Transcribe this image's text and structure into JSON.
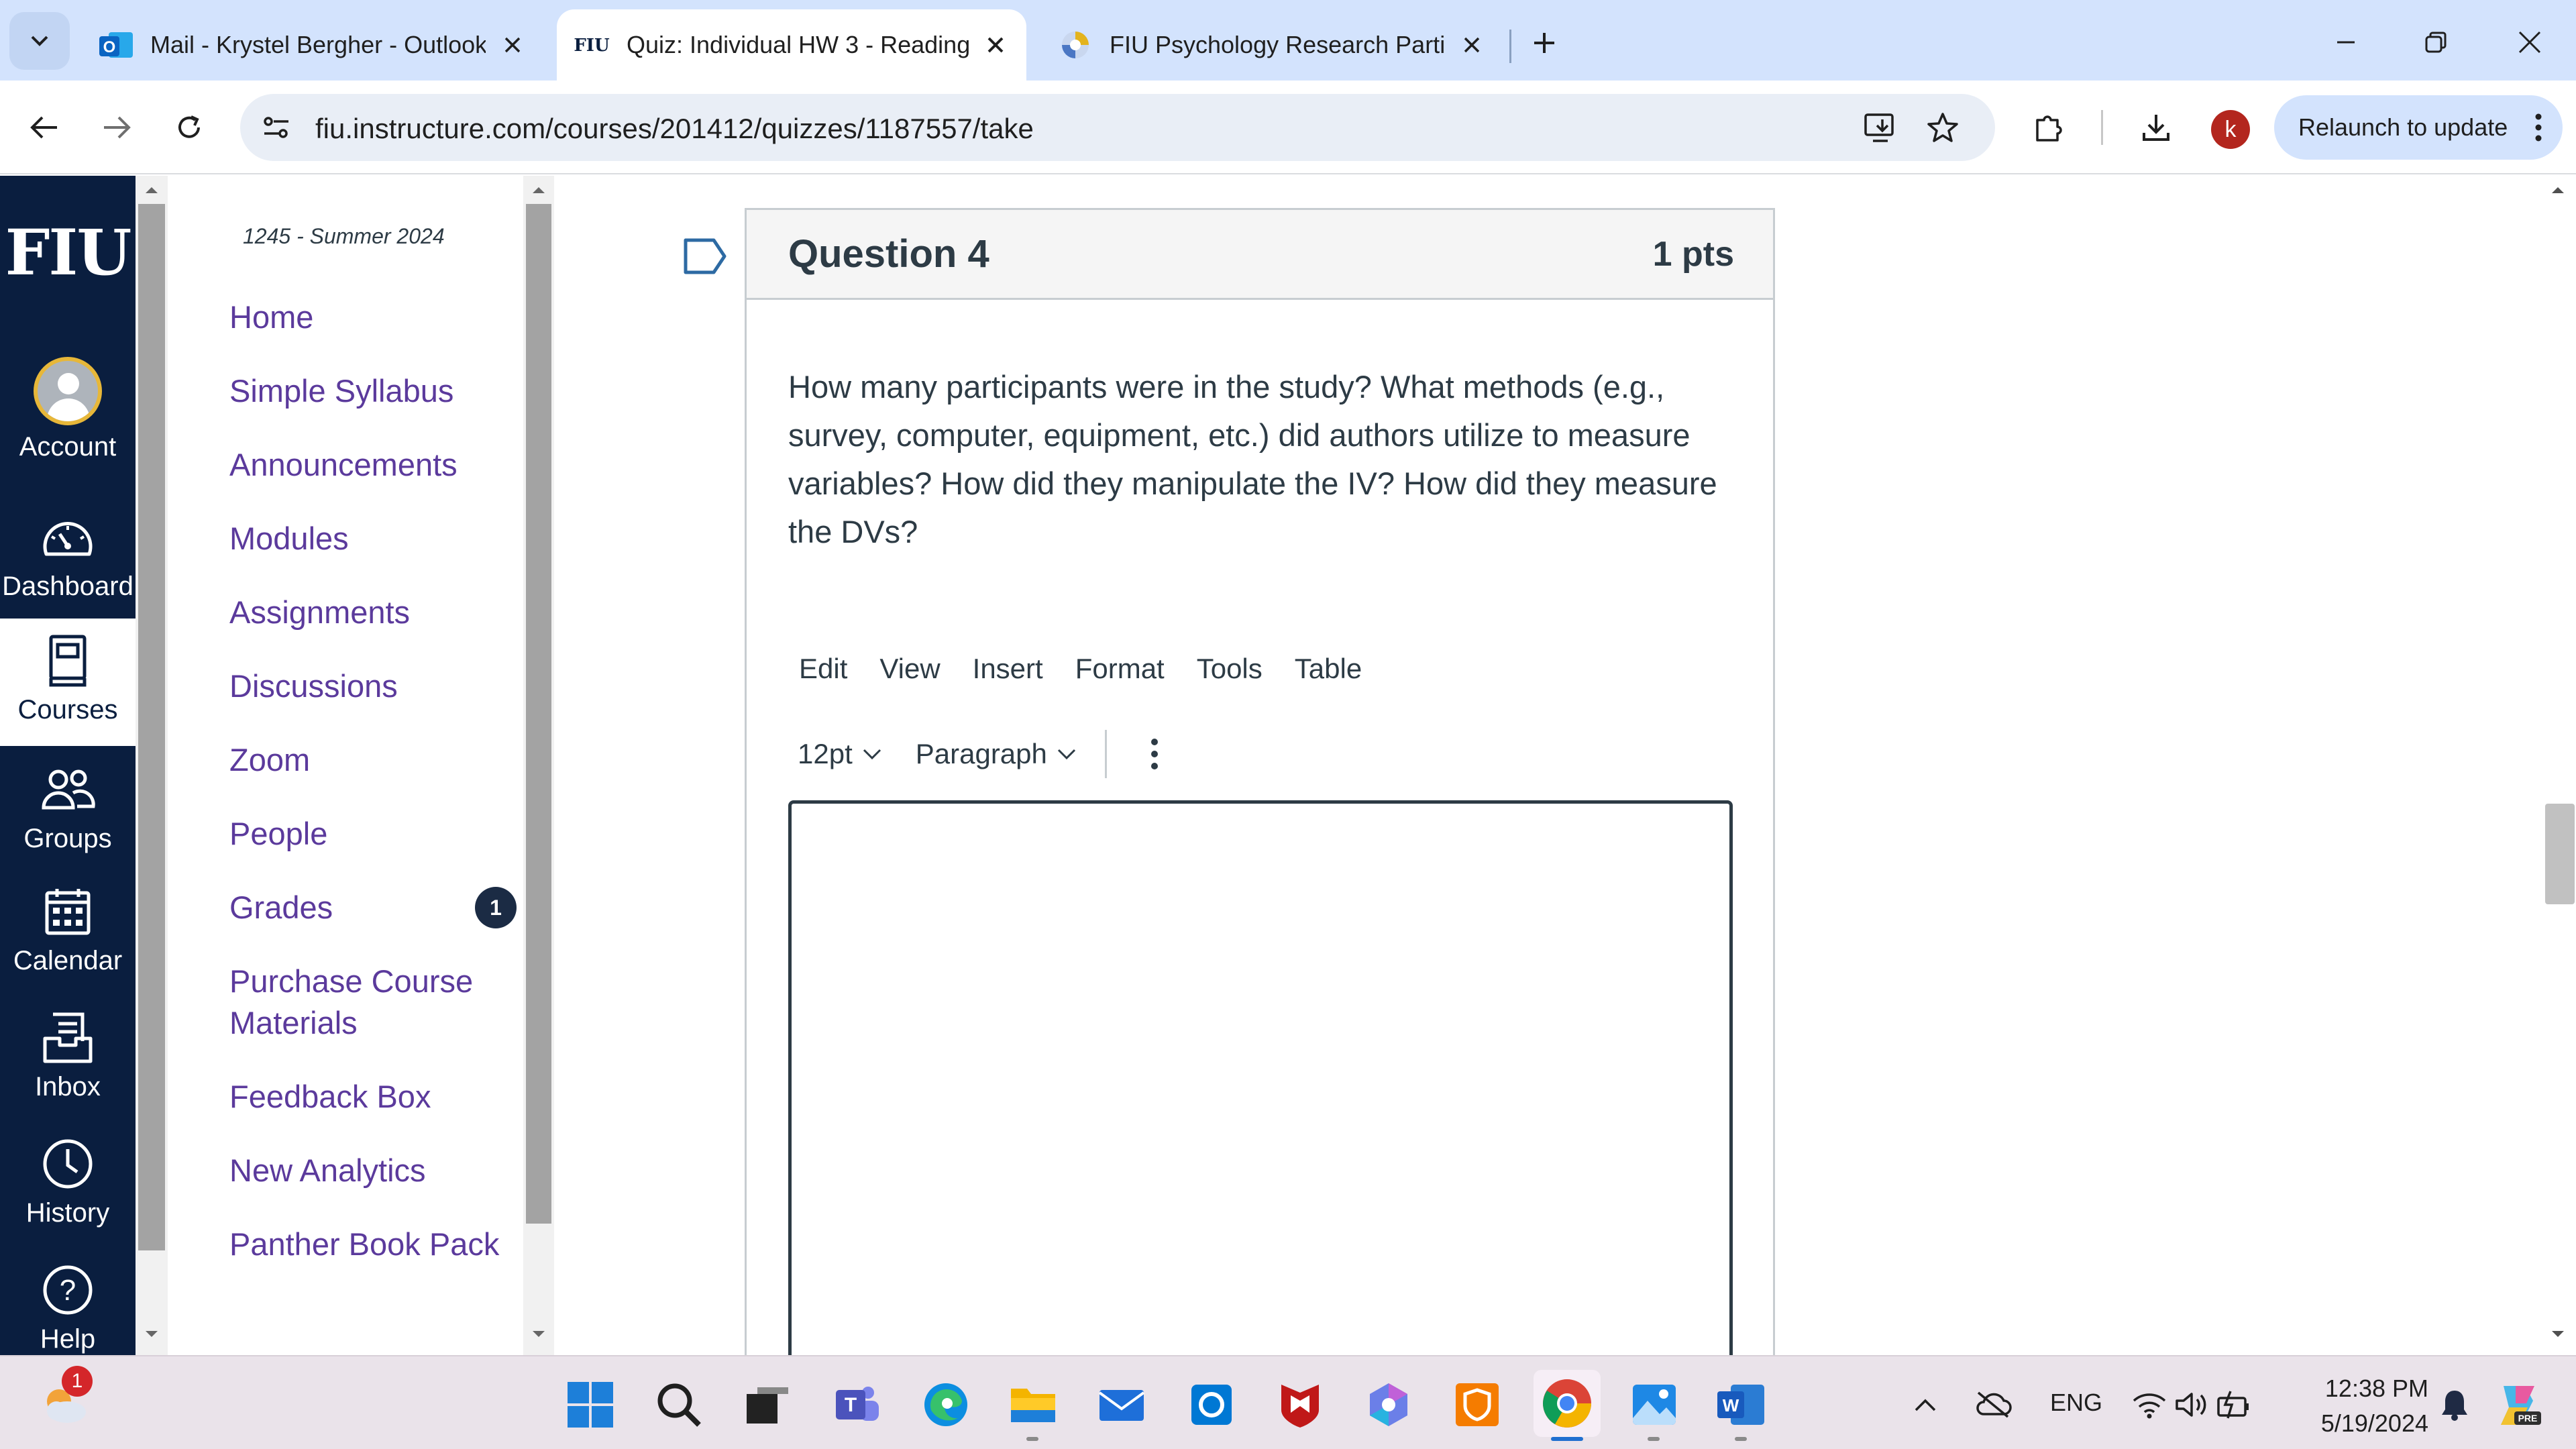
{
  "browser": {
    "tabs": [
      {
        "title": "Mail - Krystel Bergher - Outlook",
        "favicon": "outlook-icon",
        "active": false
      },
      {
        "title": "Quiz: Individual HW 3 - Reading",
        "favicon": "fiu-icon",
        "favicon_text": "FIU",
        "active": true
      },
      {
        "title": "FIU Psychology Research Partici",
        "favicon": "sona-icon",
        "active": false
      }
    ],
    "url": "fiu.instructure.com/courses/201412/quizzes/1187557/take",
    "profile_initial": "k",
    "relaunch_label": "Relaunch to update",
    "colors": {
      "tabstrip": "#d3e3fd",
      "omnibox": "#e9eef6",
      "profile": "#b3261e"
    }
  },
  "global_nav": {
    "logo": "FIU",
    "items": [
      {
        "label": "Account",
        "icon": "account-avatar-icon"
      },
      {
        "label": "Dashboard",
        "icon": "dashboard-gauge-icon"
      },
      {
        "label": "Courses",
        "icon": "courses-book-icon",
        "active": true
      },
      {
        "label": "Groups",
        "icon": "groups-icon"
      },
      {
        "label": "Calendar",
        "icon": "calendar-icon"
      },
      {
        "label": "Inbox",
        "icon": "inbox-icon"
      },
      {
        "label": "History",
        "icon": "history-clock-icon"
      },
      {
        "label": "Help",
        "icon": "help-question-icon"
      }
    ],
    "colors": {
      "background": "#0a1e3f",
      "active_background": "#ffffff"
    }
  },
  "course_nav": {
    "term": "1245 - Summer 2024",
    "items": [
      {
        "label": "Home"
      },
      {
        "label": "Simple Syllabus"
      },
      {
        "label": "Announcements"
      },
      {
        "label": "Modules"
      },
      {
        "label": "Assignments"
      },
      {
        "label": "Discussions"
      },
      {
        "label": "Zoom"
      },
      {
        "label": "People"
      },
      {
        "label": "Grades",
        "badge": "1"
      },
      {
        "label": "Purchase Course Materials"
      },
      {
        "label": "Feedback Box"
      },
      {
        "label": "New Analytics"
      },
      {
        "label": "Panther Book Pack"
      }
    ],
    "link_color": "#5b3a9c"
  },
  "question": {
    "name": "Question 4",
    "points": "1 pts",
    "text": "How many participants were in the study? What methods (e.g., survey, computer, equipment, etc.) did authors utilize to measure variables? How did they manipulate the IV? How did they measure the DVs?",
    "editor": {
      "menu": [
        "Edit",
        "View",
        "Insert",
        "Format",
        "Tools",
        "Table"
      ],
      "font_size": "12pt",
      "block_format": "Paragraph",
      "content": ""
    }
  },
  "taskbar": {
    "weather_badge": "1",
    "apps": [
      "windows-start-icon",
      "search-icon",
      "task-view-icon",
      "teams-icon",
      "edge-icon",
      "file-explorer-icon",
      "mail-icon",
      "cortana-icon",
      "mcafee-icon",
      "copilot-icon",
      "security-shield-icon",
      "chrome-icon",
      "photos-icon",
      "word-icon"
    ],
    "language": "ENG",
    "time": "12:38 PM",
    "date": "5/19/2024"
  }
}
